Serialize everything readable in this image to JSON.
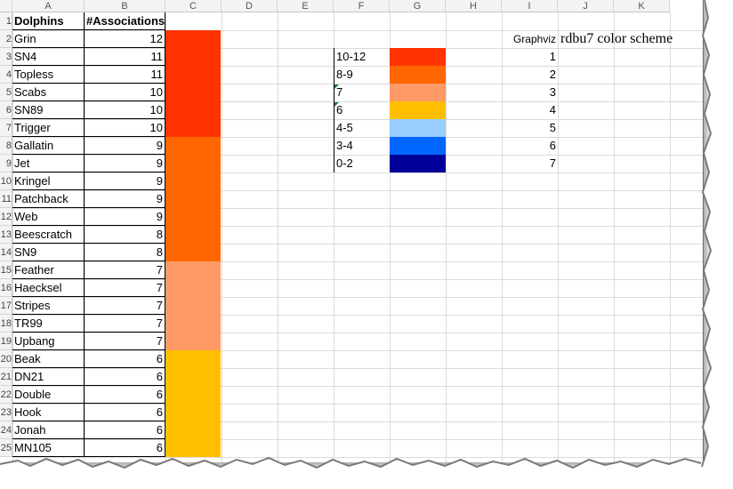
{
  "columns": [
    "A",
    "B",
    "C",
    "D",
    "E",
    "F",
    "G",
    "H",
    "I",
    "J",
    "K"
  ],
  "rows": [
    "1",
    "2",
    "3",
    "4",
    "5",
    "6",
    "7",
    "8",
    "9",
    "10",
    "11",
    "12",
    "13",
    "14",
    "15",
    "16",
    "17",
    "18",
    "19",
    "20",
    "21",
    "22",
    "23",
    "24",
    "25"
  ],
  "table": {
    "header": {
      "name": "Dolphins",
      "count": "#Associations"
    },
    "rows": [
      {
        "name": "Grin",
        "count": "12"
      },
      {
        "name": "SN4",
        "count": "11"
      },
      {
        "name": "Topless",
        "count": "11"
      },
      {
        "name": "Scabs",
        "count": "10"
      },
      {
        "name": "SN89",
        "count": "10"
      },
      {
        "name": "Trigger",
        "count": "10"
      },
      {
        "name": "Gallatin",
        "count": "9"
      },
      {
        "name": "Jet",
        "count": "9"
      },
      {
        "name": "Kringel",
        "count": "9"
      },
      {
        "name": "Patchback",
        "count": "9"
      },
      {
        "name": "Web",
        "count": "9"
      },
      {
        "name": "Beescratch",
        "count": "8"
      },
      {
        "name": "SN9",
        "count": "8"
      },
      {
        "name": "Feather",
        "count": "7"
      },
      {
        "name": "Haecksel",
        "count": "7"
      },
      {
        "name": "Stripes",
        "count": "7"
      },
      {
        "name": "TR99",
        "count": "7"
      },
      {
        "name": "Upbang",
        "count": "7"
      },
      {
        "name": "Beak",
        "count": "6"
      },
      {
        "name": "DN21",
        "count": "6"
      },
      {
        "name": "Double",
        "count": "6"
      },
      {
        "name": "Hook",
        "count": "6"
      },
      {
        "name": "Jonah",
        "count": "6"
      },
      {
        "name": "MN105",
        "count": "6"
      }
    ]
  },
  "color_band_groups": [
    {
      "color": "#ff3300",
      "rows": 6
    },
    {
      "color": "#ff6600",
      "rows": 7
    },
    {
      "color": "#ff9966",
      "rows": 5
    },
    {
      "color": "#ffbf00",
      "rows": 6
    }
  ],
  "legend": {
    "graphviz_label": "Graphviz",
    "title": "rdbu7 color scheme",
    "items": [
      {
        "range": "10-12",
        "color": "#ff3300",
        "index": "1"
      },
      {
        "range": "8-9",
        "color": "#ff6600",
        "index": "2"
      },
      {
        "range": "7",
        "color": "#ff9966",
        "index": "3"
      },
      {
        "range": "6",
        "color": "#ffbf00",
        "index": "4"
      },
      {
        "range": "4-5",
        "color": "#99ccff",
        "index": "5"
      },
      {
        "range": "3-4",
        "color": "#0066ff",
        "index": "6"
      },
      {
        "range": "0-2",
        "color": "#000099",
        "index": "7"
      }
    ]
  }
}
